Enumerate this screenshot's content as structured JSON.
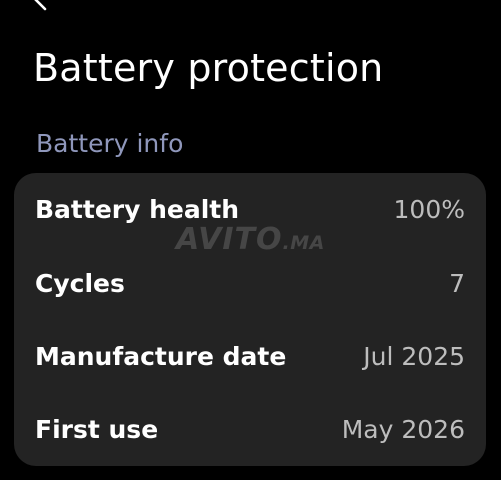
{
  "header": {
    "title": "Battery protection",
    "back_icon": "arrow-left-icon"
  },
  "section": {
    "label": "Battery info"
  },
  "rows": [
    {
      "label": "Battery health",
      "value": "100%"
    },
    {
      "label": "Cycles",
      "value": "7"
    },
    {
      "label": "Manufacture date",
      "value": "Jul 2025"
    },
    {
      "label": "First use",
      "value": "May 2026"
    }
  ],
  "watermark": {
    "main": "AVITO",
    "suffix": ".MA"
  },
  "colors": {
    "background": "#000000",
    "card": "#232323",
    "section_label": "#8f97bb",
    "value_text": "#bdbdbd"
  }
}
